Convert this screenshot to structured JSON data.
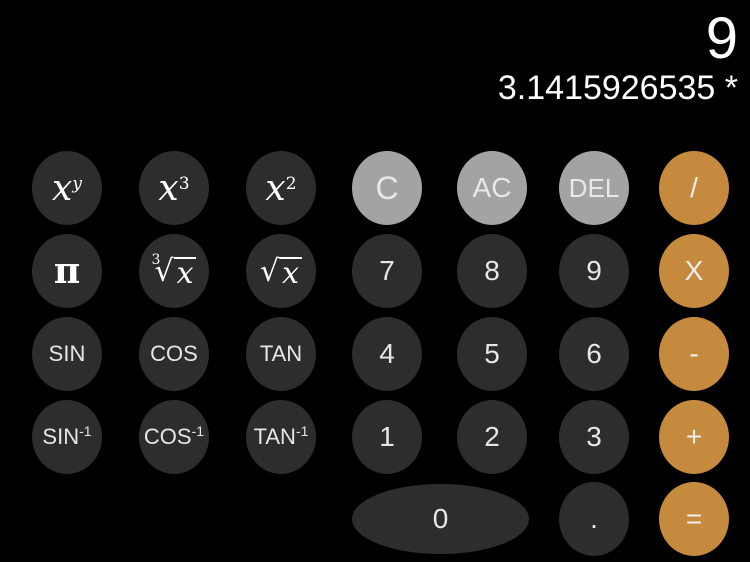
{
  "display": {
    "result": "9",
    "expression": "3.1415926535 *"
  },
  "buttons": {
    "xy": {
      "base": "x",
      "exp": "y"
    },
    "x3": {
      "base": "x",
      "exp": "3"
    },
    "x2": {
      "base": "x",
      "exp": "2"
    },
    "clear": "C",
    "all_clear": "AC",
    "delete": "DEL",
    "divide": "/",
    "pi": "π",
    "cbrt": {
      "index": "3",
      "radical": "√",
      "arg": "x"
    },
    "sqrt": {
      "radical": "√",
      "arg": "x"
    },
    "seven": "7",
    "eight": "8",
    "nine": "9",
    "multiply": "X",
    "sin": "SIN",
    "cos": "COS",
    "tan": "TAN",
    "four": "4",
    "five": "5",
    "six": "6",
    "subtract": "-",
    "asin": "SIN",
    "acos": "COS",
    "atan": "TAN",
    "inv_exp": "-1",
    "one": "1",
    "two": "2",
    "three": "3",
    "add": "+",
    "zero": "0",
    "decimal": ".",
    "equals": "="
  },
  "colors": {
    "dark": "#2d2d2d",
    "gray": "#a3a3a3",
    "orange": "#c68a3e",
    "background": "#000000"
  }
}
